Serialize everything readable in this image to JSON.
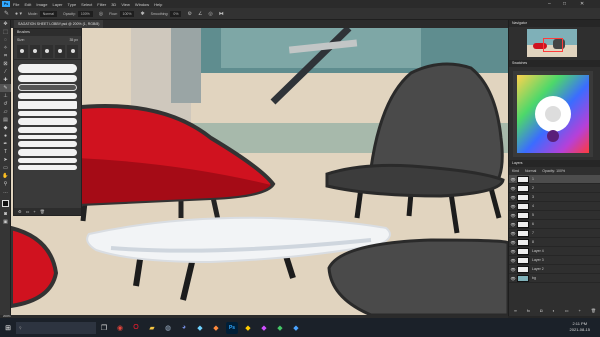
{
  "menu": {
    "app_logo": "Ps",
    "items": [
      "File",
      "Edit",
      "Image",
      "Layer",
      "Type",
      "Select",
      "Filter",
      "3D",
      "View",
      "Window",
      "Help"
    ]
  },
  "options": {
    "mode_label": "Mode:",
    "mode_value": "Normal",
    "opacity_label": "Opacity:",
    "opacity_value": "100%",
    "flow_label": "Flow:",
    "flow_value": "100%",
    "smoothing_label": "Smoothing:",
    "smoothing_value": "0%"
  },
  "document": {
    "tab_title": "SAGATION SHEET LOBBY.psd @ 200% (1, RGB/8)",
    "zoom_status": "200%"
  },
  "brush_panel": {
    "title": "Brushes",
    "size_label": "Size:",
    "size_value": "35 px"
  },
  "right_panels": {
    "navigator_title": "Navigator",
    "swatches_title": "Swatches",
    "layers_title": "Layers",
    "kind_label": "Kind",
    "blend_value": "Normal",
    "opacity_label": "Opacity: 100%",
    "layers": [
      {
        "name": "1",
        "selected": true
      },
      {
        "name": "2",
        "selected": false
      },
      {
        "name": "3",
        "selected": false
      },
      {
        "name": "4",
        "selected": false
      },
      {
        "name": "5",
        "selected": false
      },
      {
        "name": "6",
        "selected": false
      },
      {
        "name": "7",
        "selected": false
      },
      {
        "name": "8",
        "selected": false
      },
      {
        "name": "Layer 4",
        "selected": false
      },
      {
        "name": "Layer 3",
        "selected": false
      },
      {
        "name": "Layer 2",
        "selected": false
      },
      {
        "name": "bg",
        "selected": false
      }
    ]
  },
  "taskbar": {
    "time": "2:11 PM",
    "date": "2021-08-15"
  },
  "colors": {
    "chair_red": "#d0121f",
    "chair_dark": "#4a4a4a",
    "floor": "#e1d4bf",
    "ps_blue": "#31a8ff"
  }
}
